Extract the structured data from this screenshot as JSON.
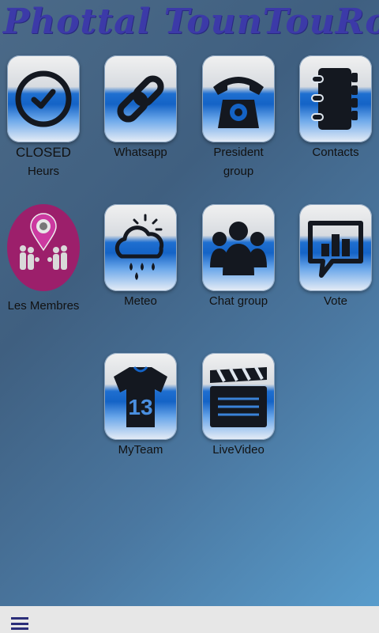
{
  "app": {
    "title": "Phottal TounTouRoun"
  },
  "tiles": [
    {
      "id": "closed",
      "line1": "CLOSED",
      "line2": "Heurs",
      "icon": "clock-icon"
    },
    {
      "id": "whatsapp",
      "line1": "Whatsapp",
      "icon": "chain-link-icon"
    },
    {
      "id": "president",
      "line1": "President",
      "line2": "group",
      "icon": "telephone-icon"
    },
    {
      "id": "contacts",
      "line1": "Contacts",
      "icon": "address-book-icon"
    },
    {
      "id": "membres",
      "line1": "Les Membres",
      "icon": "members-location-icon"
    },
    {
      "id": "meteo",
      "line1": "Meteo",
      "icon": "weather-cloud-icon"
    },
    {
      "id": "chat",
      "line1": "Chat group",
      "icon": "people-group-icon"
    },
    {
      "id": "vote",
      "line1": "Vote",
      "icon": "bar-chart-speech-icon"
    },
    {
      "id": "myteam",
      "line1": "MyTeam",
      "jersey_number": "13",
      "icon": "jersey-icon"
    },
    {
      "id": "livevideo",
      "line1": "LiveVideo",
      "icon": "clapperboard-icon"
    }
  ],
  "colors": {
    "title": "#3c3aa8",
    "tile_blue": "#1463c6",
    "members_circle": "#9c1f6b",
    "bottom_bar": "#e7e7e7",
    "menu_icon": "#2b2e79"
  },
  "bottom_bar": {
    "menu_icon": "hamburger-menu-icon"
  }
}
